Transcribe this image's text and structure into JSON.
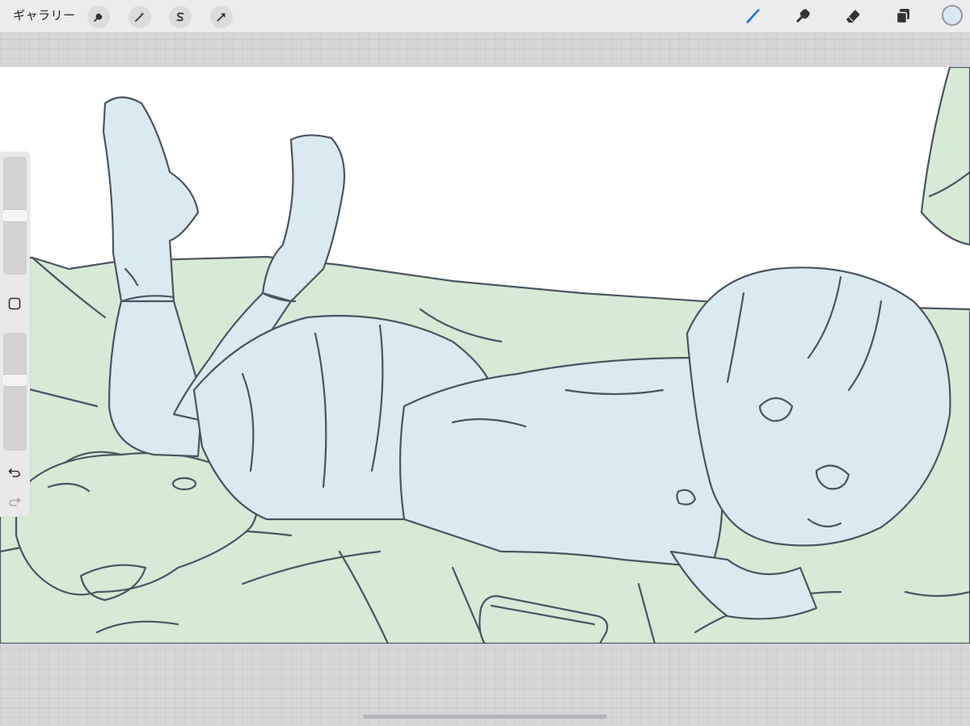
{
  "app": {
    "gallery_label": "ギャラリー"
  },
  "toolbar": {
    "left_tools": [
      {
        "icon": "wrench-icon",
        "name": "actions"
      },
      {
        "icon": "magic-wand-icon",
        "name": "adjustments"
      },
      {
        "icon": "selection-s-icon",
        "name": "selection"
      },
      {
        "icon": "arrow-cursor-icon",
        "name": "transform"
      }
    ],
    "right_tools": [
      {
        "icon": "brush-icon",
        "name": "paint",
        "active": true
      },
      {
        "icon": "smudge-icon",
        "name": "smudge",
        "active": false
      },
      {
        "icon": "eraser-icon",
        "name": "erase",
        "active": false
      },
      {
        "icon": "layers-icon",
        "name": "layers",
        "active": false
      }
    ],
    "active_color": "#d9e8f2",
    "accent_color": "#1a73e8"
  },
  "sidebar": {
    "brush_size_level": 0.24,
    "opacity_level": 0.4,
    "modify_icon": "square-icon",
    "undo_icon": "undo-icon",
    "redo_icon": "redo-icon"
  },
  "canvas": {
    "artwork": "line-art-illustration",
    "colors": {
      "skin_clothes_fill": "#daeaf1",
      "bed_fill": "#d6ead6",
      "line": "#4a5560",
      "background": "#ffffff"
    }
  }
}
